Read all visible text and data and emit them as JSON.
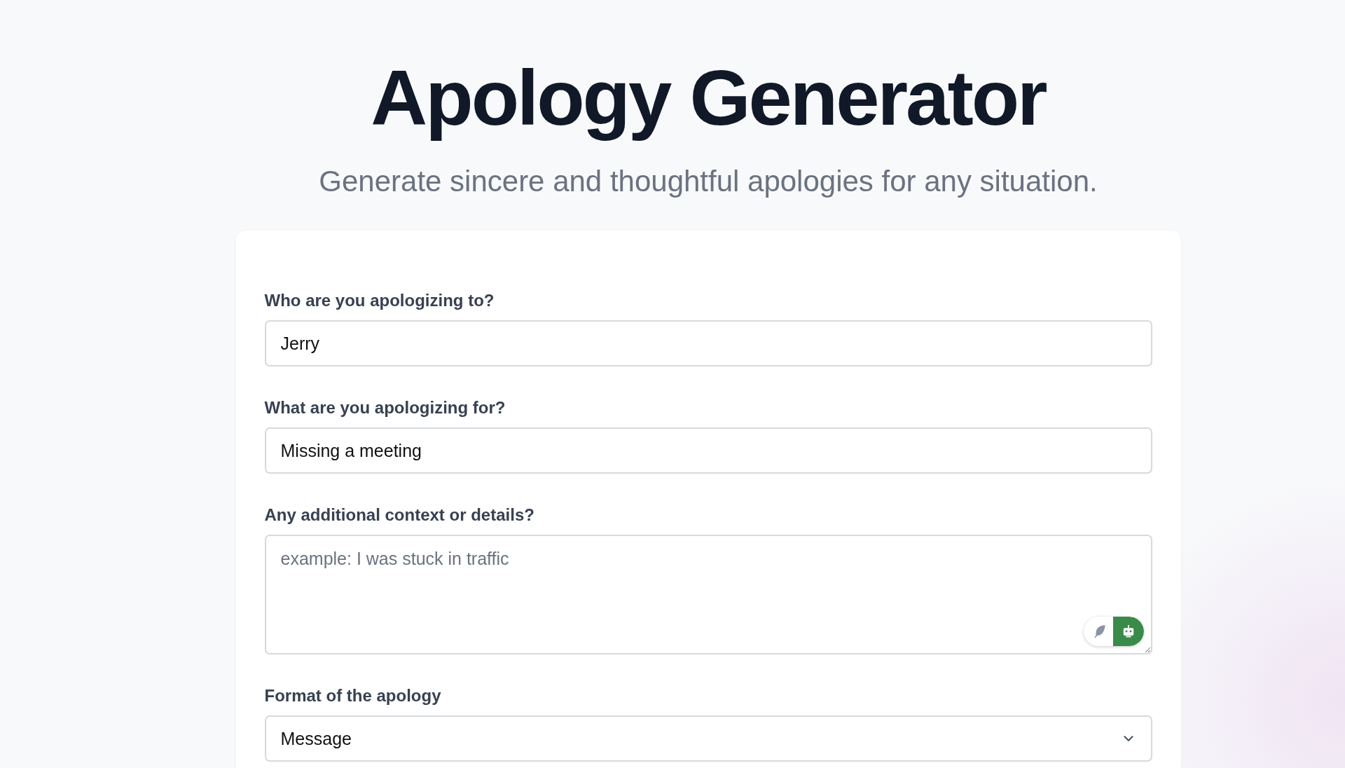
{
  "header": {
    "title": "Apology Generator",
    "subtitle": "Generate sincere and thoughtful apologies for any situation."
  },
  "form": {
    "fields": [
      {
        "kind": "text",
        "label": "Who are you apologizing to?",
        "value": "Jerry"
      },
      {
        "kind": "text",
        "label": "What are you apologizing for?",
        "value": "Missing a meeting"
      },
      {
        "kind": "textarea",
        "label": "Any additional context or details?",
        "placeholder": "example: I was stuck in traffic",
        "assistant_on": true
      },
      {
        "kind": "select",
        "label": "Format of the apology",
        "value": "Message"
      }
    ]
  }
}
